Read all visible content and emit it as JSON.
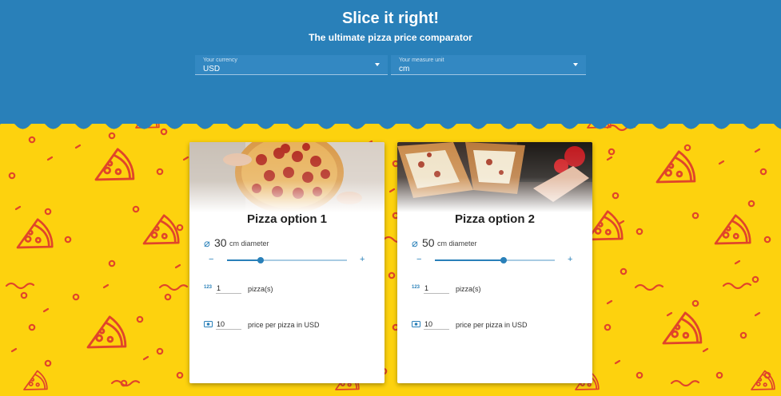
{
  "header": {
    "title": "Slice it right!",
    "subtitle": "The ultimate pizza price comparator"
  },
  "currency_select": {
    "label": "Your currency",
    "value": "USD"
  },
  "unit_select": {
    "label": "Your measure unit",
    "value": "cm"
  },
  "colors": {
    "header_blue": "#2980b9",
    "background_yellow": "#fdd20e",
    "pattern_red": "#e0452a"
  },
  "pizzas": [
    {
      "title": "Pizza option 1",
      "image_icon": "pepperoni-pizza-photo",
      "diameter_icon": "diameter-icon",
      "diameter": "30",
      "diameter_unit_label": "cm diameter",
      "slider_fraction": 0.28,
      "slider_minus": "−",
      "slider_plus": "+",
      "count_icon_text": "123",
      "count": "1",
      "count_label": "pizza(s)",
      "price_icon": "money-icon",
      "price": "10",
      "price_label": "price per pizza in USD"
    },
    {
      "title": "Pizza option 2",
      "image_icon": "pizza-slices-photo",
      "diameter_icon": "diameter-icon",
      "diameter": "50",
      "diameter_unit_label": "cm diameter",
      "slider_fraction": 0.57,
      "slider_minus": "−",
      "slider_plus": "+",
      "count_icon_text": "123",
      "count": "1",
      "count_label": "pizza(s)",
      "price_icon": "money-icon",
      "price": "10",
      "price_label": "price per pizza in USD"
    }
  ]
}
